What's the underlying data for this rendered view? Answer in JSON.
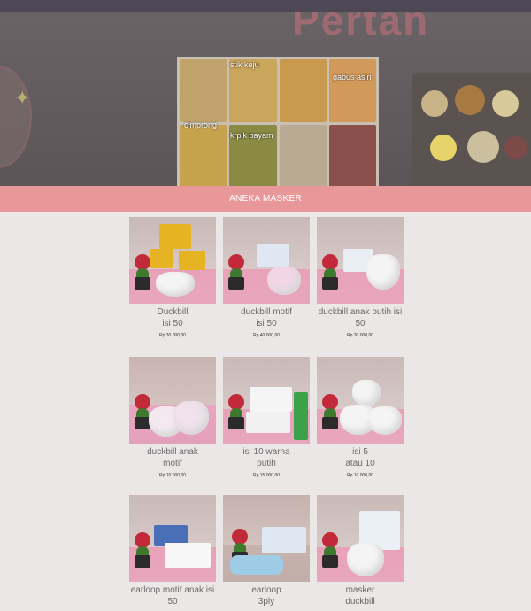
{
  "hero": {
    "pink_word": "Pertan",
    "poster_labels": [
      "stik keju",
      "cimprong",
      "gabus asin",
      "krpik bayam"
    ]
  },
  "section": {
    "title": "ANEKA MASKER"
  },
  "products": [
    {
      "name": "Duckbill\nisi 50",
      "price": "Rp 30.000,00"
    },
    {
      "name": "duckbill motif\nisi 50",
      "price": "Rp 40.000,00"
    },
    {
      "name": "duckbill anak putih isi\n50",
      "price": "Rp 30.000,00"
    },
    {
      "name": "duckbill anak\nmotif",
      "price": "Rp 10.000,00"
    },
    {
      "name": "isi 10 warna\nputih",
      "price": "Rp 15.000,00"
    },
    {
      "name": "isi 5\natau 10",
      "price": "Rp 10.000,00"
    },
    {
      "name": "earloop motif anak isi\n50",
      "price": ""
    },
    {
      "name": "earloop\n3ply",
      "price": ""
    },
    {
      "name": "masker\nduckbill",
      "price": ""
    }
  ],
  "colors": {
    "section_bar": "#e9989a",
    "page_bg": "#ebe7e6",
    "topbar": "#4e4755"
  }
}
